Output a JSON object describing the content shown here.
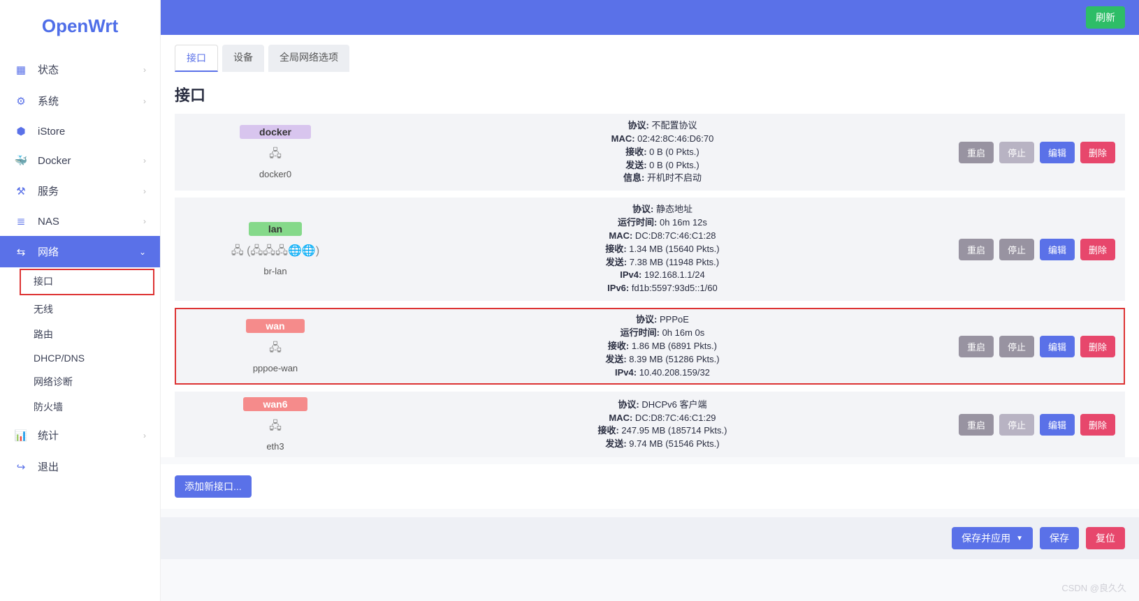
{
  "app": {
    "logo": "OpenWrt"
  },
  "topbar": {
    "refresh": "刷新"
  },
  "sidebar": {
    "items": [
      {
        "icon": "▦",
        "label": "状态",
        "expandable": true
      },
      {
        "icon": "⚙",
        "label": "系统",
        "expandable": true
      },
      {
        "icon": "⬢",
        "label": "iStore",
        "expandable": false
      },
      {
        "icon": "🐳",
        "label": "Docker",
        "expandable": true
      },
      {
        "icon": "⚒",
        "label": "服务",
        "expandable": true
      },
      {
        "icon": "≣",
        "label": "NAS",
        "expandable": true
      },
      {
        "icon": "⇆",
        "label": "网络",
        "expandable": true,
        "active": true
      },
      {
        "icon": "📊",
        "label": "统计",
        "expandable": true
      },
      {
        "icon": "↪",
        "label": "退出",
        "expandable": false
      }
    ],
    "network_sub": [
      {
        "label": "接口",
        "selected": true
      },
      {
        "label": "无线"
      },
      {
        "label": "路由"
      },
      {
        "label": "DHCP/DNS"
      },
      {
        "label": "网络诊断"
      },
      {
        "label": "防火墙"
      }
    ]
  },
  "tabs": [
    {
      "label": "接口",
      "active": true
    },
    {
      "label": "设备"
    },
    {
      "label": "全局网络选项"
    }
  ],
  "page_title": "接口",
  "labels": {
    "protocol": "协议:",
    "mac": "MAC:",
    "rx": "接收:",
    "tx": "发送:",
    "info": "信息:",
    "uptime": "运行时间:",
    "ipv4": "IPv4:",
    "ipv6": "IPv6:"
  },
  "actions": {
    "restart": "重启",
    "stop": "停止",
    "edit": "编辑",
    "delete": "删除",
    "add": "添加新接口...",
    "save_apply": "保存并应用",
    "save": "保存",
    "reset": "复位"
  },
  "interfaces": [
    {
      "name": "docker",
      "dev": "docker0",
      "badge": "purple",
      "highlight": false,
      "stop_disabled": true,
      "stats": {
        "protocol": "不配置协议",
        "mac": "02:42:8C:46:D6:70",
        "rx": "0 B (0 Pkts.)",
        "tx": "0 B (0 Pkts.)",
        "info": "开机时不启动"
      }
    },
    {
      "name": "lan",
      "dev": "br-lan",
      "badge": "green",
      "dev_icons": "🖧 (🖧🖧🖧🌐🌐)",
      "stats": {
        "protocol": "静态地址",
        "uptime": "0h 16m 12s",
        "mac": "DC:D8:7C:46:C1:28",
        "rx": "1.34 MB (15640 Pkts.)",
        "tx": "7.38 MB (11948 Pkts.)",
        "ipv4": "192.168.1.1/24",
        "ipv6": "fd1b:5597:93d5::1/60"
      }
    },
    {
      "name": "wan",
      "dev": "pppoe-wan",
      "badge": "salmon",
      "highlight": true,
      "stats": {
        "protocol": "PPPoE",
        "uptime": "0h 16m 0s",
        "rx": "1.86 MB (6891 Pkts.)",
        "tx": "8.39 MB (51286 Pkts.)",
        "ipv4": "10.40.208.159/32"
      }
    },
    {
      "name": "wan6",
      "dev": "eth3",
      "badge": "salmon",
      "stop_disabled": true,
      "stats": {
        "protocol": "DHCPv6 客户端",
        "mac": "DC:D8:7C:46:C1:29",
        "rx": "247.95 MB (185714 Pkts.)",
        "tx": "9.74 MB (51546 Pkts.)"
      }
    }
  ],
  "watermark": "CSDN @良久久"
}
